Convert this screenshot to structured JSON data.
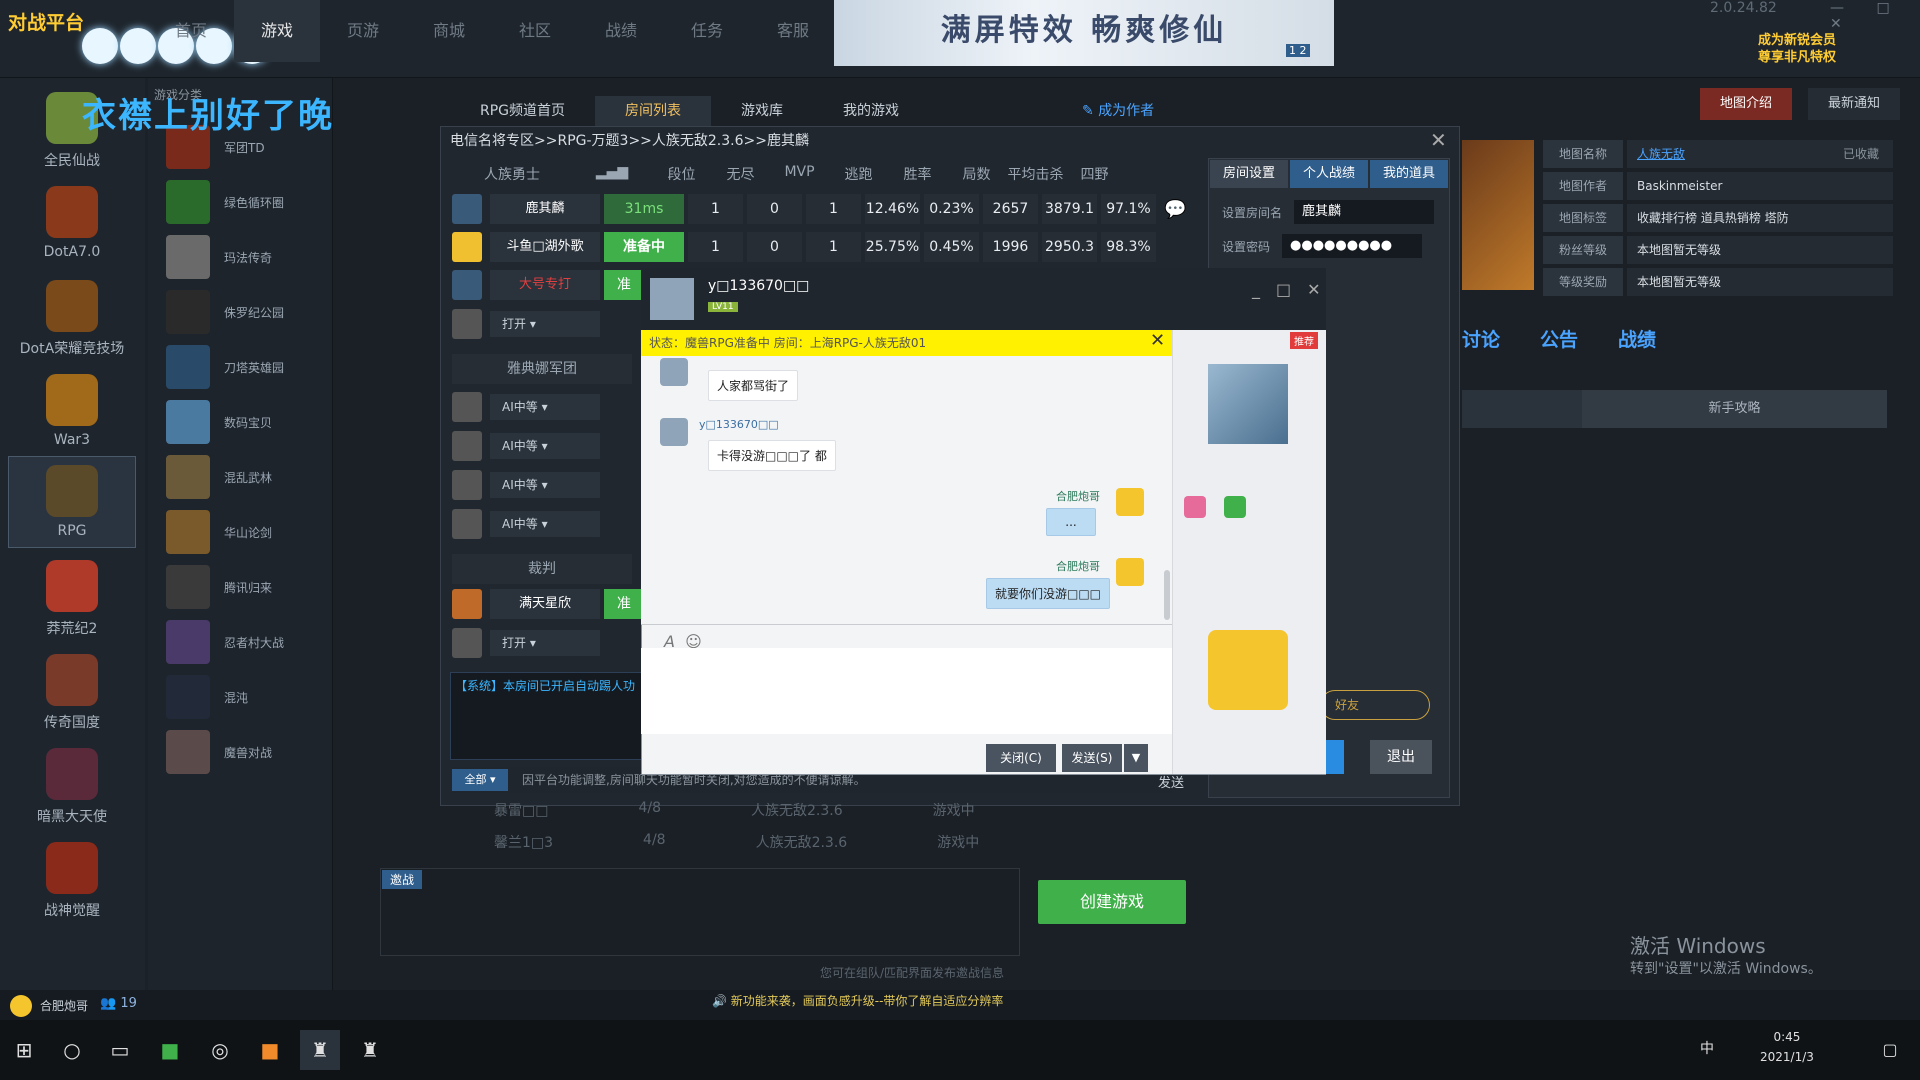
{
  "app": {
    "logo_text": "对战平台",
    "version": "2.0.24.82",
    "vip_line1": "成为新锐会员",
    "vip_line2": "尊享非凡特权",
    "window_controls": "— □ ✕"
  },
  "topnav": [
    "首页",
    "游戏",
    "页游",
    "商城",
    "社区",
    "战绩",
    "任务",
    "客服"
  ],
  "banner": {
    "text": "满屏特效 畅爽修仙",
    "pages": "1 2"
  },
  "overlay_title": "衣襟上别好了晚霞",
  "leftbar": [
    {
      "label": "全民仙战"
    },
    {
      "label": "DotA7.0"
    },
    {
      "label": "DotA荣耀竞技场"
    },
    {
      "label": "War3"
    },
    {
      "label": "RPG",
      "active": true
    },
    {
      "label": "莽荒纪2"
    },
    {
      "label": "传奇国度"
    },
    {
      "label": "暗黑大天使"
    },
    {
      "label": "战神觉醒"
    }
  ],
  "category_header": "游戏分类",
  "categories": [
    "军团TD",
    "绿色循环圈",
    "玛法传奇",
    "侏罗纪公园",
    "刀塔英雄园",
    "数码宝贝",
    "混乱武林",
    "华山论剑",
    "腾讯归来",
    "忍者村大战",
    "混沌",
    "魔兽对战"
  ],
  "subtabs": {
    "items": [
      "RPG频道首页",
      "房间列表",
      "游戏库",
      "我的游戏"
    ],
    "selected": "房间列表",
    "author": "成为作者"
  },
  "map_buttons": {
    "intro": "地图介绍",
    "notice": "最新通知"
  },
  "map_info": [
    {
      "k": "地图名称",
      "v": "人族无敌",
      "extra": "已收藏"
    },
    {
      "k": "地图作者",
      "v": "Baskinmeister"
    },
    {
      "k": "地图标签",
      "v": "收藏排行榜   道具热销榜   塔防"
    },
    {
      "k": "粉丝等级",
      "v": "本地图暂无等级"
    },
    {
      "k": "等级奖励",
      "v": "本地图暂无等级"
    }
  ],
  "map_tabs": [
    "讨论",
    "公告",
    "战绩"
  ],
  "guide": "新手攻略",
  "room": {
    "title": "电信名将专区>>RPG-万题3>>人族无敌2.3.6>>鹿其麟",
    "headers": [
      "人族勇士",
      "",
      "段位",
      "无尽",
      "MVP",
      "逃跑",
      "胜率",
      "局数",
      "平均击杀",
      "四野"
    ],
    "players": [
      {
        "name": "鹿其麟",
        "status": "31ms",
        "c": [
          "1",
          "0",
          "1",
          "12.46%",
          "0.23%",
          "2657",
          "3879.1",
          "97.1%"
        ]
      },
      {
        "name": "斗鱼□湖外歌",
        "status": "准备中",
        "c": [
          "1",
          "0",
          "1",
          "25.75%",
          "0.45%",
          "1996",
          "2950.3",
          "98.3%"
        ]
      },
      {
        "name": "大号专打",
        "status": "准"
      }
    ],
    "open_label": "打开",
    "team2": "雅典娜军团",
    "ai": [
      "AI中等",
      "AI中等",
      "AI中等",
      "AI中等"
    ],
    "judge": "裁判",
    "judge_name": "满天星欣",
    "judge_status": "准",
    "system_msg": "【系统】本房间已开启自动踢人功",
    "notice_select": "全部",
    "notice": "因平台功能调整,房间聊天功能暂时关闭,对您造成的不便请谅解。",
    "send": "发送"
  },
  "right_panel": {
    "tabs": [
      "房间设置",
      "个人战绩",
      "我的道具"
    ],
    "room_name_label": "设置房间名",
    "room_name": "鹿其麟",
    "password_label": "设置密码",
    "password": "●●●●●●●●●",
    "friend": "好友",
    "exit": "退出"
  },
  "room_list": [
    {
      "name": "暴雷□□",
      "slots": "4/8",
      "map": "人族无敌2.3.6",
      "state": "游戏中"
    },
    {
      "name": "馨兰1□3",
      "slots": "4/8",
      "map": "人族无敌2.3.6",
      "state": "游戏中"
    }
  ],
  "invite": {
    "tag": "邀战",
    "hint": "您可在组队/匹配界面发布邀战信息"
  },
  "create_game": "创建游戏",
  "chat": {
    "name": "y□133670□□",
    "level": "LV11",
    "status": "状态：魔兽RPG准备中 房间：上海RPG-人族无敌01",
    "recommend": "推荐",
    "messages": [
      {
        "from": "them",
        "text": "人家都骂街了"
      },
      {
        "from": "them",
        "sender": "y□133670□□",
        "text": "卡得没游□□□了 都"
      },
      {
        "from": "me",
        "sender": "合肥炮哥",
        "text": "..."
      },
      {
        "from": "me",
        "sender": "合肥炮哥",
        "text": "就要你们没游□□□"
      }
    ],
    "close": "关闭(C)",
    "send": "发送(S)"
  },
  "statusbar": {
    "user": "合肥炮哥",
    "friends": "19",
    "notice": "新功能来袭，画面负感升级--带你了解自适应分辨率"
  },
  "taskbar": {
    "ime": "中",
    "time": "0:45",
    "date": "2021/1/3"
  },
  "activate": {
    "line1": "激活 Windows",
    "line2": "转到\"设置\"以激活 Windows。"
  },
  "colors": {
    "accent": "#4aa3ff",
    "ready": "#3fb04a",
    "status_yellow": "#fff100",
    "bg": "#1b2128"
  }
}
